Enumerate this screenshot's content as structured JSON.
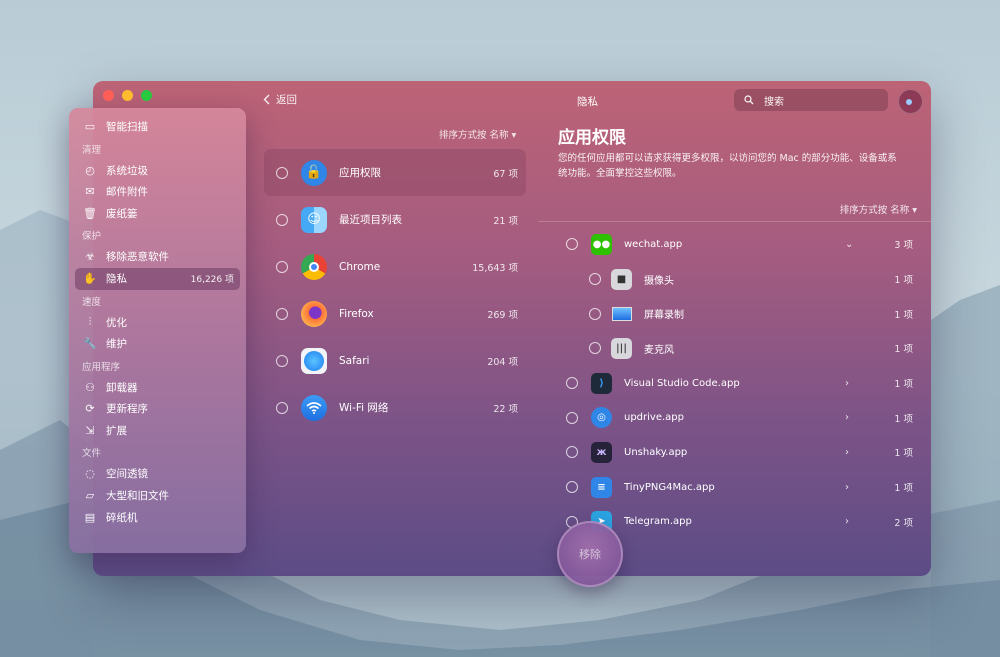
{
  "window": {
    "title": "隐私"
  },
  "nav": {
    "back_label": "返回"
  },
  "search": {
    "placeholder": "搜索"
  },
  "sidebar": {
    "top": {
      "label": "智能扫描"
    },
    "sections": [
      {
        "header": "清理",
        "items": [
          {
            "label": "系统垃圾"
          },
          {
            "label": "邮件附件"
          },
          {
            "label": "废纸篓"
          }
        ]
      },
      {
        "header": "保护",
        "items": [
          {
            "label": "移除恶意软件"
          },
          {
            "label": "隐私",
            "count": "16,226 项",
            "active": true
          }
        ]
      },
      {
        "header": "速度",
        "items": [
          {
            "label": "优化"
          },
          {
            "label": "维护"
          }
        ]
      },
      {
        "header": "应用程序",
        "items": [
          {
            "label": "卸载器"
          },
          {
            "label": "更新程序"
          },
          {
            "label": "扩展"
          }
        ]
      },
      {
        "header": "文件",
        "items": [
          {
            "label": "空间透镜"
          },
          {
            "label": "大型和旧文件"
          },
          {
            "label": "碎纸机"
          }
        ]
      }
    ]
  },
  "middle": {
    "sort_label": "排序方式按 名称 ▾",
    "items": [
      {
        "name": "应用权限",
        "count": "67 项",
        "selected": true
      },
      {
        "name": "最近项目列表",
        "count": "21 项"
      },
      {
        "name": "Chrome",
        "count": "15,643 项"
      },
      {
        "name": "Firefox",
        "count": "269 项"
      },
      {
        "name": "Safari",
        "count": "204 项"
      },
      {
        "name": "Wi-Fi 网络",
        "count": "22 项"
      }
    ]
  },
  "detail": {
    "title": "应用权限",
    "description": "您的任何应用都可以请求获得更多权限，以访问您的 Mac 的部分功能、设备或系统功能。全面掌控这些权限。",
    "sort_label": "排序方式按 名称 ▾",
    "items": [
      {
        "name": "wechat.app",
        "count": "3 项",
        "expanded": true
      },
      {
        "name": "摄像头",
        "count": "1 项",
        "sub": true
      },
      {
        "name": "屏幕录制",
        "count": "1 项",
        "sub": true
      },
      {
        "name": "麦克风",
        "count": "1 项",
        "sub": true
      },
      {
        "name": "Visual Studio Code.app",
        "count": "1 项"
      },
      {
        "name": "updrive.app",
        "count": "1 项"
      },
      {
        "name": "Unshaky.app",
        "count": "1 项"
      },
      {
        "name": "TinyPNG4Mac.app",
        "count": "1 项"
      },
      {
        "name": "Telegram.app",
        "count": "2 项"
      }
    ]
  },
  "actions": {
    "remove_label": "移除"
  },
  "colors": {
    "close": "#ff5f57",
    "minimize": "#febc2e",
    "zoom": "#28c840"
  }
}
